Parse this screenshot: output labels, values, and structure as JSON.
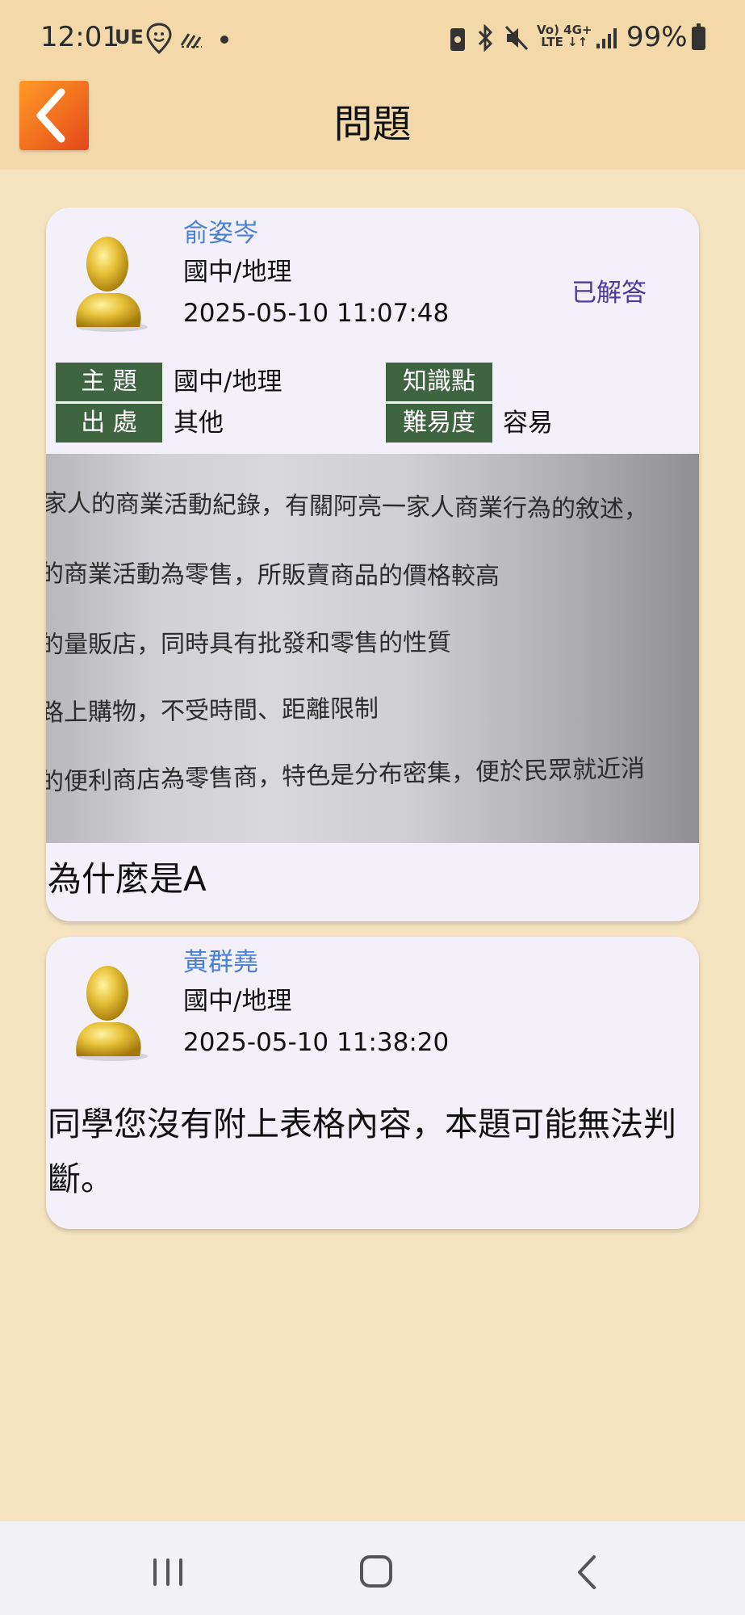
{
  "status_bar": {
    "time": "12:01",
    "carrier_tag": "UE",
    "network": "Vo) 4G+ LTE",
    "battery_percent": "99%",
    "icons": [
      "location-pin-icon",
      "signal-lines-icon",
      "dot-icon",
      "vpn-icon",
      "bluetooth-icon",
      "mute-icon",
      "lte-icon",
      "signal-bars-icon",
      "battery-icon"
    ]
  },
  "header": {
    "title": "問題",
    "back_icon": "chevron-left-icon"
  },
  "question_post": {
    "author": "俞姿岑",
    "subject": "國中/地理",
    "datetime": "2025-05-10 11:07:48",
    "status": "已解答",
    "tags": {
      "topic_label": "主 題",
      "topic_value": "國中/地理",
      "source_label": "出 處",
      "source_value": "其他",
      "knowledge_label": "知識點",
      "knowledge_value": "",
      "difficulty_label": "難易度",
      "difficulty_value": "容易"
    },
    "image_lines": [
      "家人的商業活動紀錄，有關阿亮一家人商業行為的敘述，",
      "的商業活動為零售，所販賣商品的價格較高",
      "的量販店，同時具有批發和零售的性質",
      "路上購物，不受時間、距離限制",
      "的便利商店為零售商，特色是分布密集，便於民眾就近消"
    ],
    "question_text": "為什麼是A"
  },
  "answer_post": {
    "author": "黃群堯",
    "subject": "國中/地理",
    "datetime": "2025-05-10 11:38:20",
    "reply_text": "同學您沒有附上表格內容，本題可能無法判斷。"
  },
  "nav_bar": {
    "icons": [
      "recent-apps-icon",
      "home-icon",
      "back-icon"
    ]
  },
  "colors": {
    "page_bg": "#f5e3c0",
    "header_bg": "#f3d9a9",
    "card_bg": "#f3f0f9",
    "tag_bg": "#3f6440",
    "author_color": "#4a7fd4",
    "status_color": "#4a3a9a",
    "back_button": "#f06a1e"
  }
}
